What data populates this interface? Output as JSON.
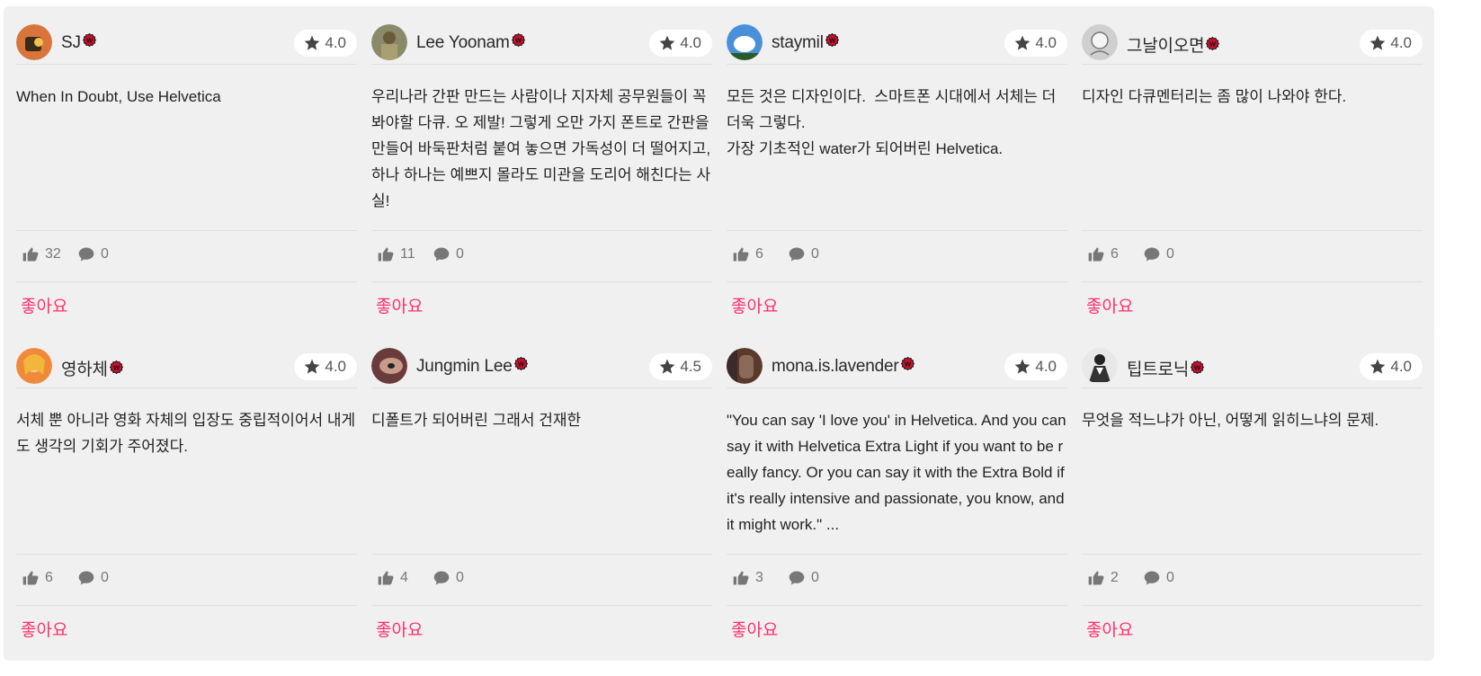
{
  "cards": [
    {
      "user": "SJ",
      "rating": "4.0",
      "text": "When In Doubt, Use Helvetica",
      "likes": "32",
      "comments": "0",
      "like_label": "좋아요",
      "avatar_color": "#d9743b"
    },
    {
      "user": "Lee Yoonam",
      "rating": "4.0",
      "text": "우리나라 간판 만드는 사람이나 지자체 공무원들이 꼭 봐야할 다큐. 오 제발! 그렇게 오만 가지 폰트로 간판을 만들어 바둑판처럼 붙여 놓으면 가독성이 더 떨어지고, 하나 하나는 예쁘지 몰라도 미관을 도리어 해친다는 사실!",
      "likes": "11",
      "comments": "0",
      "like_label": "좋아요",
      "avatar_color": "#8a8a6a"
    },
    {
      "user": "staymil",
      "rating": "4.0",
      "text": "모든 것은 디자인이다.  스마트폰 시대에서 서체는 더더욱 그렇다.\n가장 기초적인 water가 되어버린 Helvetica.",
      "likes": "6",
      "comments": "0",
      "like_label": "좋아요",
      "avatar_color": "#4a90d9"
    },
    {
      "user": "그날이오면",
      "rating": "4.0",
      "text": "디자인 다큐멘터리는 좀 많이 나와야 한다.",
      "likes": "6",
      "comments": "0",
      "like_label": "좋아요",
      "avatar_color": "#cfcfcf"
    },
    {
      "user": "영하체",
      "rating": "4.0",
      "text": "서체 뿐 아니라 영화 자체의 입장도 중립적이어서 내게도 생각의 기회가 주어졌다.",
      "likes": "6",
      "comments": "0",
      "like_label": "좋아요",
      "avatar_color": "#f08a3a"
    },
    {
      "user": "Jungmin Lee",
      "rating": "4.5",
      "text": "디폴트가 되어버린 그래서 건재한",
      "likes": "4",
      "comments": "0",
      "like_label": "좋아요",
      "avatar_color": "#6a3b3b"
    },
    {
      "user": "mona.is.lavender",
      "rating": "4.0",
      "text": "\"You can say 'I love you' in Helvetica. And you can say it with Helvetica Extra Light if you want to be really fancy. Or you can say it with the Extra Bold if it's really intensive and passionate, you know, and it might work.\" ...",
      "likes": "3",
      "comments": "0",
      "like_label": "좋아요",
      "avatar_color": "#5a3a2a"
    },
    {
      "user": "팁트로닉",
      "rating": "4.0",
      "text": "무엇을 적느냐가 아닌, 어떻게 읽히느냐의 문제.",
      "likes": "2",
      "comments": "0",
      "like_label": "좋아요",
      "avatar_color": "#e8e8e8"
    }
  ],
  "colors": {
    "card_bg": "#f0f0f0",
    "accent": "#ff2f6e",
    "badge": "#c8102e"
  },
  "icons": {
    "badge": "verified-badge-icon",
    "star": "star-icon",
    "like": "thumbs-up-icon",
    "comment": "speech-bubble-icon"
  }
}
